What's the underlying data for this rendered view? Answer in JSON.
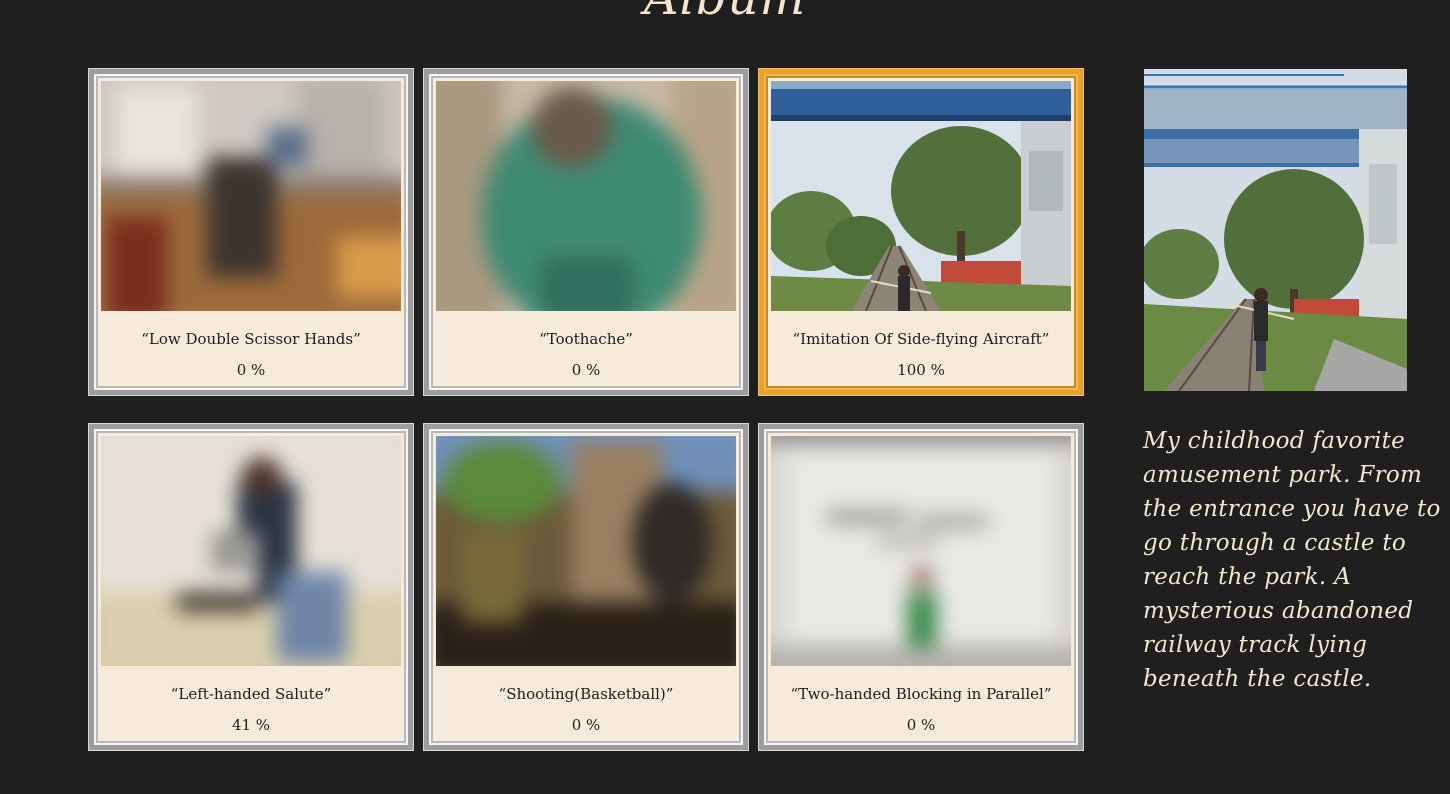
{
  "page": {
    "title": "Album"
  },
  "album": {
    "items": [
      {
        "title": "“Low Double Scissor Hands”",
        "percent": "0 %"
      },
      {
        "title": "“Toothache”",
        "percent": "0 %"
      },
      {
        "title": "“Imitation Of Side-flying Aircraft”",
        "percent": "100 %"
      },
      {
        "title": "“Left-handed Salute”",
        "percent": "41 %"
      },
      {
        "title": "“Shooting(Basketball)”",
        "percent": "0 %"
      },
      {
        "title": "“Two-handed Blocking in Parallel”",
        "percent": "0 %"
      }
    ],
    "selected_index": 2
  },
  "detail": {
    "description": "My childhood favorite amusement park. From the entrance you have to go through a castle to reach the park. A mysterious abandoned railway track lying beneath the castle."
  },
  "colors": {
    "background": "#1f1f1f",
    "card_paper": "#f6eadb",
    "selected_frame": "#e5a02e",
    "frame": "#9d9d9d",
    "text_light": "#f5e6d0"
  }
}
